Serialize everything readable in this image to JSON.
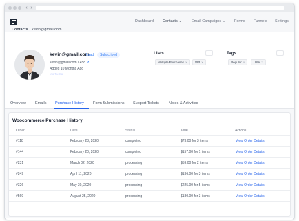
{
  "nav": {
    "items": [
      {
        "label": "Dashboard",
        "caret": ""
      },
      {
        "label": "Contacts",
        "caret": "⌄"
      },
      {
        "label": "Email Campaigns",
        "caret": "⌄"
      },
      {
        "label": "Forms",
        "caret": ""
      },
      {
        "label": "Funnels",
        "caret": ""
      },
      {
        "label": "Settings",
        "caret": ""
      }
    ],
    "active_index": 1
  },
  "breadcrumb": {
    "root": "Contacts",
    "separator": "|",
    "current": "kevin@gmail.com"
  },
  "profile": {
    "email": "kevin@gmail.com",
    "status": "Lead",
    "badge": "Subscribed",
    "id_line": "kevin@gmail.com / 458",
    "added": "Added 10 Months Ago",
    "faded_text": "Mo  Tu  Sa"
  },
  "lists": {
    "title": "Lists",
    "chips": [
      "Multiple Purchases",
      "VIP"
    ]
  },
  "tags": {
    "title": "Tags",
    "chips": [
      "Regular",
      "USA"
    ]
  },
  "tabs": [
    "Overview",
    "Emails",
    "Purchase History",
    "Form Submissions",
    "Support Tickets",
    "Notes & Activities"
  ],
  "active_tab": "Purchase History",
  "table": {
    "title": "Woocommerce Purchase History",
    "columns": [
      "Order",
      "Date",
      "Status",
      "Total",
      "Actions"
    ],
    "rows": [
      [
        "#118",
        "February 23, 2020",
        "completed",
        "$73.00 for 3 items",
        "View Order Details"
      ],
      [
        "#144",
        "February 20, 2020",
        "completed",
        "$157.00 for 1 items",
        "View Order Details"
      ],
      [
        "#231",
        "March 02, 2020",
        "processing",
        "$59.00 for 2 items",
        "View Order Details"
      ],
      [
        "#249",
        "April 11, 2020",
        "processing",
        "$136.00 for 3 items",
        "View Order Details"
      ],
      [
        "#326",
        "May 30, 2020",
        "processing",
        "$225.00 for 5 items",
        "View Order Details"
      ],
      [
        "#569",
        "August 25, 2020",
        "processing",
        "$180.00 for 3 items",
        "View Order Details"
      ]
    ]
  },
  "colors": {
    "accent": "#2563eb",
    "text": "#1f2937",
    "muted": "#6b7280"
  }
}
